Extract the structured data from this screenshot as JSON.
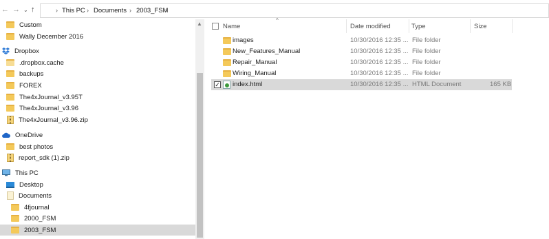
{
  "address": {
    "back_icon": "back-arrow-icon",
    "forward_icon": "forward-arrow-icon",
    "dropdown_icon": "chevron-down-icon",
    "up_icon": "up-arrow-icon",
    "crumbs": [
      "This PC",
      "Documents",
      "2003_FSM"
    ]
  },
  "nav": {
    "items": [
      {
        "label": "Custom",
        "icon": "folder-icon"
      },
      {
        "label": "Wally December 2016",
        "icon": "folder-icon"
      },
      {
        "label": "Dropbox",
        "icon": "dropbox-icon"
      },
      {
        "label": ".dropbox.cache",
        "icon": "folder-icon"
      },
      {
        "label": "backups",
        "icon": "folder-icon"
      },
      {
        "label": "FOREX",
        "icon": "folder-icon"
      },
      {
        "label": "The4xJournal_v3.95T",
        "icon": "folder-icon"
      },
      {
        "label": "The4xJournal_v3.96",
        "icon": "folder-icon"
      },
      {
        "label": "The4xJournal_v3.96.zip",
        "icon": "zip-icon"
      },
      {
        "label": "OneDrive",
        "icon": "onedrive-icon"
      },
      {
        "label": "best photos",
        "icon": "folder-icon"
      },
      {
        "label": "report_sdk (1).zip",
        "icon": "zip-icon"
      },
      {
        "label": "This PC",
        "icon": "computer-icon"
      },
      {
        "label": "Desktop",
        "icon": "desktop-icon"
      },
      {
        "label": "Documents",
        "icon": "documents-icon"
      },
      {
        "label": "4fjournal",
        "icon": "folder-icon"
      },
      {
        "label": "2000_FSM",
        "icon": "folder-icon"
      },
      {
        "label": "2003_FSM",
        "icon": "folder-icon"
      }
    ]
  },
  "columns": {
    "name": "Name",
    "date": "Date modified",
    "type": "Type",
    "size": "Size"
  },
  "files": [
    {
      "name": "images",
      "date": "10/30/2016 12:35 ...",
      "type": "File folder",
      "size": "",
      "icon": "folder-icon"
    },
    {
      "name": "New_Features_Manual",
      "date": "10/30/2016 12:35 ...",
      "type": "File folder",
      "size": "",
      "icon": "folder-icon"
    },
    {
      "name": "Repair_Manual",
      "date": "10/30/2016 12:35 ...",
      "type": "File folder",
      "size": "",
      "icon": "folder-icon"
    },
    {
      "name": "Wiring_Manual",
      "date": "10/30/2016 12:35 ...",
      "type": "File folder",
      "size": "",
      "icon": "folder-icon"
    },
    {
      "name": "index.html",
      "date": "10/30/2016 12:35 ...",
      "type": "HTML Document",
      "size": "165 KB",
      "icon": "html-file-icon",
      "checked": true
    }
  ],
  "colors": {
    "selection": "#d9d9d9",
    "folder": "#f4c95a",
    "dropbox": "#2f7bd6",
    "onedrive": "#1f66c8"
  }
}
